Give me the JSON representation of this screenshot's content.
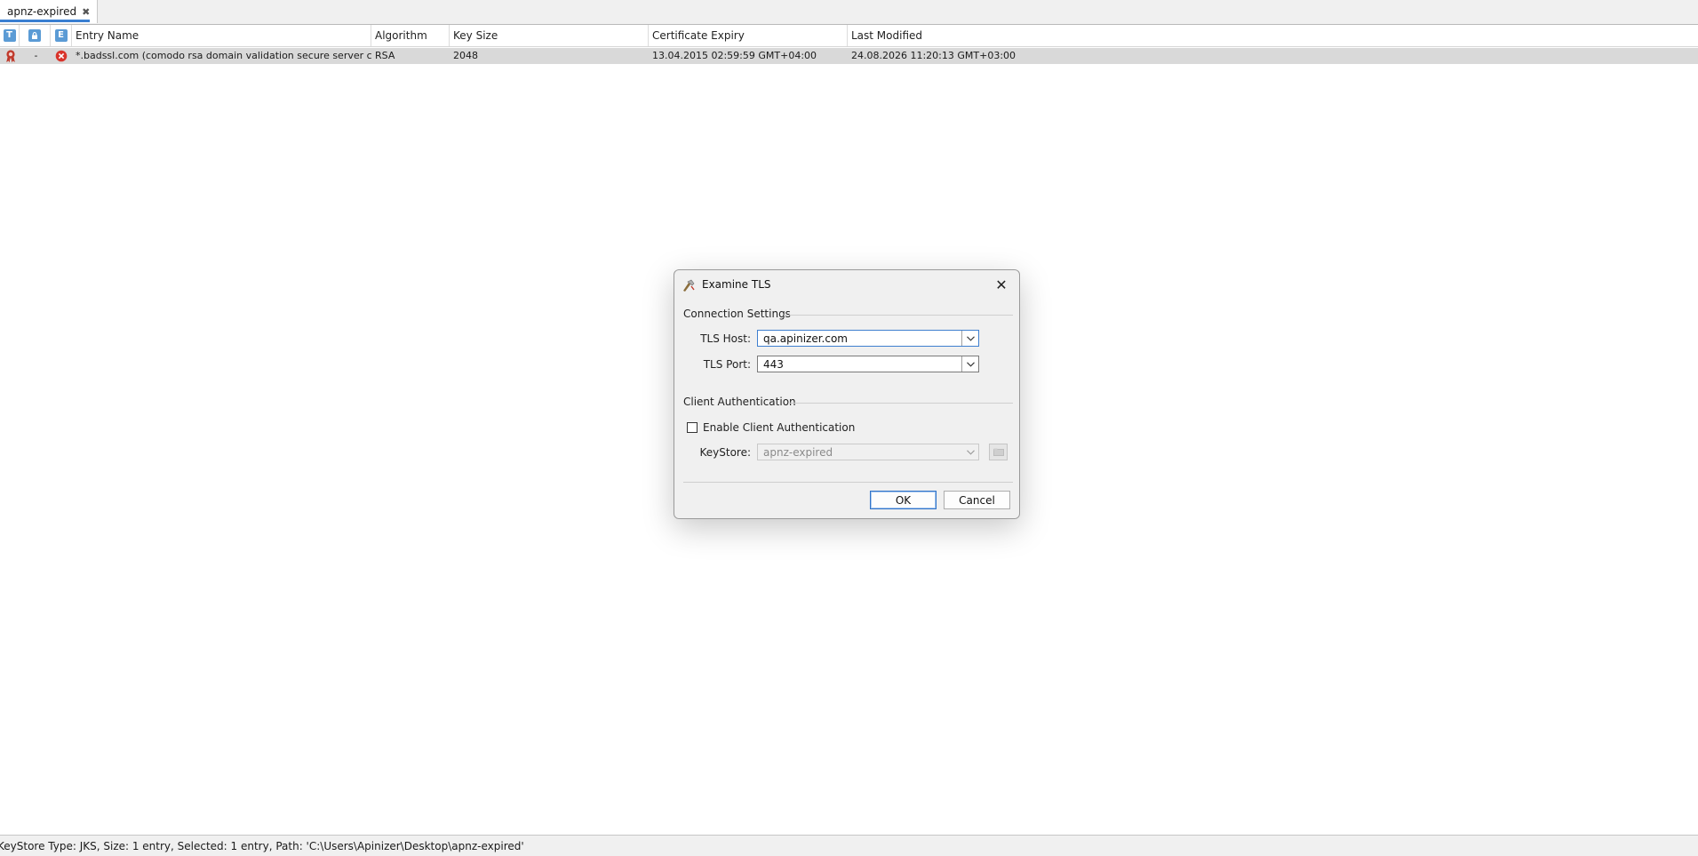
{
  "tab": {
    "label": "apnz-expired",
    "close_glyph": "✖"
  },
  "table": {
    "columns": {
      "type_icon": "T",
      "lock_icon": "lock-icon",
      "expiry_icon": "E",
      "entry_name": "Entry Name",
      "algorithm": "Algorithm",
      "key_size": "Key Size",
      "certificate_expiry": "Certificate Expiry",
      "last_modified": "Last Modified"
    },
    "rows": [
      {
        "type_icon": "certificate-icon",
        "lock": "-",
        "expiry_icon": "expired-error-icon",
        "entry_name": "*.badssl.com (comodo rsa domain validation secure server ca)",
        "algorithm": "RSA",
        "key_size": "2048",
        "certificate_expiry": "13.04.2015 02:59:59 GMT+04:00",
        "last_modified": "24.08.2026 11:20:13 GMT+03:00"
      }
    ]
  },
  "status_bar": "KeyStore Type: JKS, Size: 1 entry, Selected: 1 entry, Path: 'C:\\Users\\Apinizer\\Desktop\\apnz-expired'",
  "dialog": {
    "title": "Examine TLS",
    "close_glyph": "✕",
    "connection_section": "Connection Settings",
    "tls_host_label": "TLS Host:",
    "tls_host_value": "qa.apinizer.com",
    "tls_port_label": "TLS Port:",
    "tls_port_value": "443",
    "client_auth_section": "Client Authentication",
    "enable_client_auth_label": "Enable Client Authentication",
    "enable_client_auth_checked": false,
    "keystore_label": "KeyStore:",
    "keystore_value": "apnz-expired",
    "ok_label": "OK",
    "cancel_label": "Cancel"
  },
  "colors": {
    "accent": "#3a7fd1",
    "selected_row": "#d9d9d9",
    "error": "#d9342b"
  }
}
